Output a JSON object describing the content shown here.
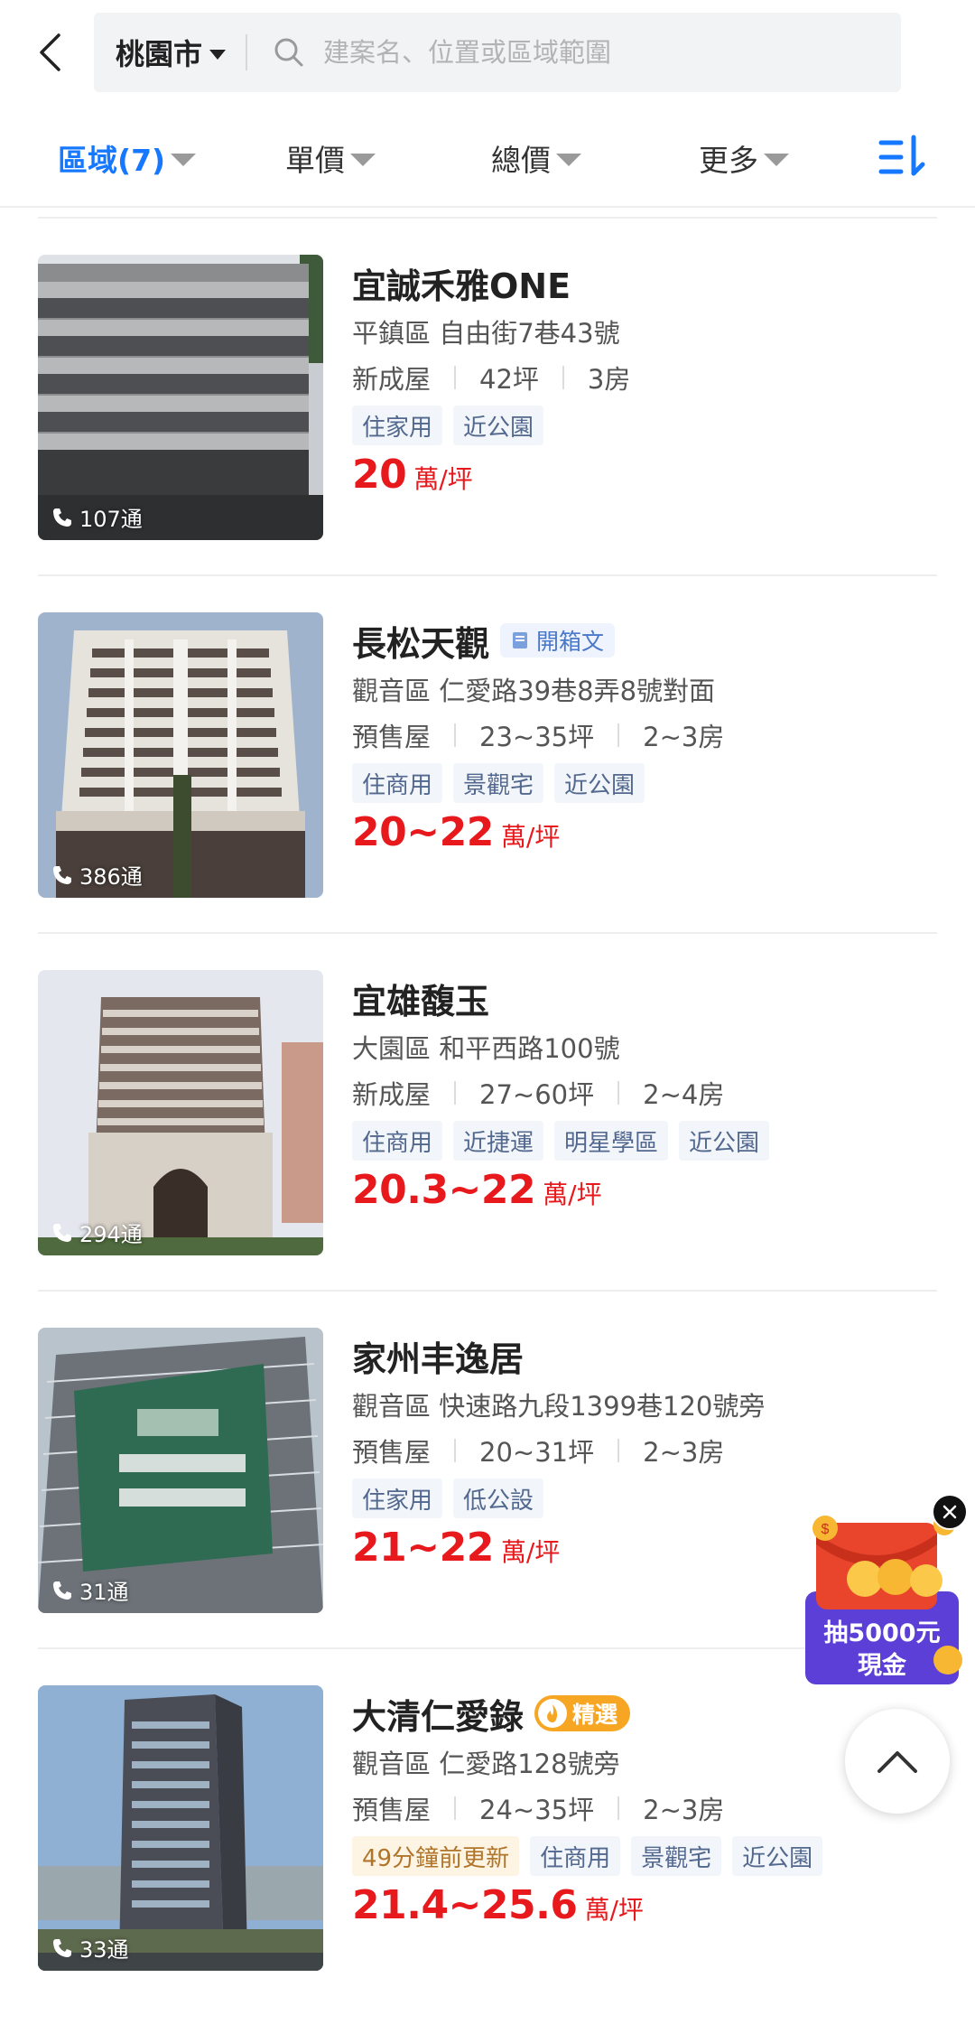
{
  "header": {
    "city": "桃園市",
    "search_placeholder": "建案名、位置或區域範圍",
    "icons": {
      "back": "back-arrow-icon",
      "search": "search-icon",
      "dropdown": "caret-down-icon"
    }
  },
  "filters": [
    {
      "label": "區域(7)",
      "active": true
    },
    {
      "label": "單價",
      "active": false
    },
    {
      "label": "總價",
      "active": false
    },
    {
      "label": "更多",
      "active": false
    }
  ],
  "sort_icon": "sort-icon",
  "colors": {
    "accent": "#1677ff",
    "price": "#e8191c",
    "featured": "#f6a623"
  },
  "listings": [
    {
      "name": "宜誠禾雅ONE",
      "address": "平鎮區  自由街7巷43號",
      "type": "新成屋",
      "size": "42坪",
      "rooms": "3房",
      "tags": [
        "住家用",
        "近公園"
      ],
      "price": "20",
      "price_unit": "萬/坪",
      "calls": "107通"
    },
    {
      "name": "長松天觀",
      "badge": "開箱文",
      "address": "觀音區  仁愛路39巷8弄8號對面",
      "type": "預售屋",
      "size": "23~35坪",
      "rooms": "2~3房",
      "tags": [
        "住商用",
        "景觀宅",
        "近公園"
      ],
      "price": "20~22",
      "price_unit": "萬/坪",
      "calls": "386通"
    },
    {
      "name": "宜雄馥玉",
      "address": "大園區  和平西路100號",
      "type": "新成屋",
      "size": "27~60坪",
      "rooms": "2~4房",
      "tags": [
        "住商用",
        "近捷運",
        "明星學區",
        "近公園"
      ],
      "price": "20.3~22",
      "price_unit": "萬/坪",
      "calls": "294通"
    },
    {
      "name": "家州丰逸居",
      "address": "觀音區  快速路九段1399巷120號旁",
      "type": "預售屋",
      "size": "20~31坪",
      "rooms": "2~3房",
      "tags": [
        "住家用",
        "低公設"
      ],
      "price": "21~22",
      "price_unit": "萬/坪",
      "calls": "31通"
    },
    {
      "name": "大清仁愛錄",
      "featured": "精選",
      "address": "觀音區  仁愛路128號旁",
      "type": "預售屋",
      "size": "24~35坪",
      "rooms": "2~3房",
      "update_tag": "49分鐘前更新",
      "tags": [
        "住商用",
        "景觀宅",
        "近公園"
      ],
      "price": "21.4~25.6",
      "price_unit": "萬/坪",
      "calls": "33通"
    }
  ],
  "promo": {
    "line1": "抽5000元",
    "line2": "現金"
  }
}
